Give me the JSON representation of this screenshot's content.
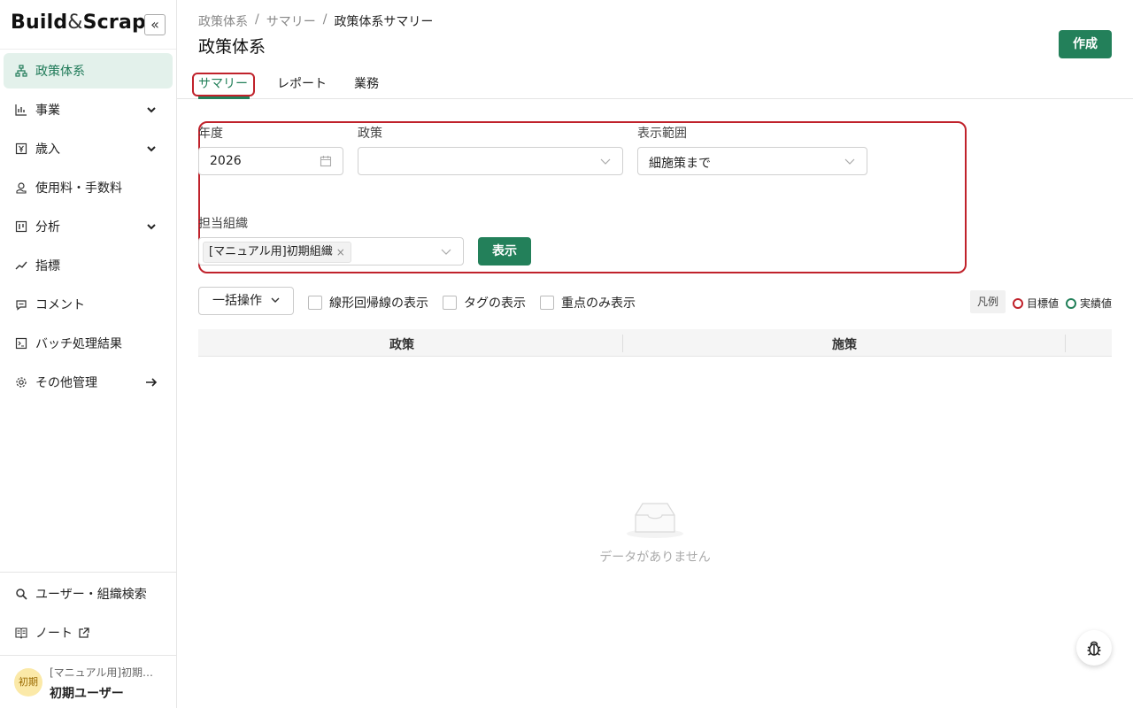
{
  "sidebar": {
    "logo": {
      "part1": "Build",
      "amp": "&",
      "part2": "Scrap"
    },
    "collapse_label": "«",
    "items": [
      {
        "label": "政策体系",
        "icon": "org-chart-icon",
        "active": true
      },
      {
        "label": "事業",
        "icon": "bar-chart-icon",
        "expandable": true
      },
      {
        "label": "歳入",
        "icon": "yen-icon",
        "expandable": true
      },
      {
        "label": "使用料・手数料",
        "icon": "coins-icon"
      },
      {
        "label": "分析",
        "icon": "board-icon",
        "expandable": true
      },
      {
        "label": "指標",
        "icon": "trend-icon"
      },
      {
        "label": "コメント",
        "icon": "comment-icon"
      },
      {
        "label": "バッチ処理結果",
        "icon": "terminal-icon"
      },
      {
        "label": "その他管理",
        "icon": "gear-icon",
        "arrow": true
      }
    ],
    "bottom_items": [
      {
        "label": "ユーザー・組織検索",
        "icon": "search-icon"
      },
      {
        "label": "ノート",
        "icon": "book-icon",
        "external": true
      }
    ],
    "user": {
      "avatar_text": "初期",
      "org": "[マニュアル用]初期…",
      "name": "初期ユーザー"
    }
  },
  "header": {
    "breadcrumb": [
      "政策体系",
      "サマリー",
      "政策体系サマリー"
    ],
    "separator": "/",
    "title": "政策体系",
    "create_label": "作成",
    "tabs": [
      {
        "label": "サマリー",
        "active": true
      },
      {
        "label": "レポート"
      },
      {
        "label": "業務"
      }
    ]
  },
  "filters": {
    "year_label": "年度",
    "year_value": "2026",
    "policy_label": "政策",
    "policy_value": "",
    "range_label": "表示範囲",
    "range_value": "細施策まで",
    "org_label": "担当組織",
    "org_tag": "[マニュアル用]初期組織",
    "org_tag_remove": "×",
    "show_label": "表示"
  },
  "toolbar": {
    "bulk_label": "一括操作",
    "checks": [
      {
        "label": "線形回帰線の表示",
        "checked": false
      },
      {
        "label": "タグの表示",
        "checked": false
      },
      {
        "label": "重点のみ表示",
        "checked": false
      }
    ],
    "legend_label": "凡例",
    "legend_items": [
      {
        "label": "目標値",
        "color": "#c0222b"
      },
      {
        "label": "実績値",
        "color": "#23805a"
      }
    ]
  },
  "table": {
    "columns": [
      "政策",
      "施策"
    ],
    "empty_text": "データがありません"
  },
  "colors": {
    "accent": "#23805a",
    "highlight_box": "#c0222b",
    "active_nav_bg": "#e3f1eb"
  }
}
